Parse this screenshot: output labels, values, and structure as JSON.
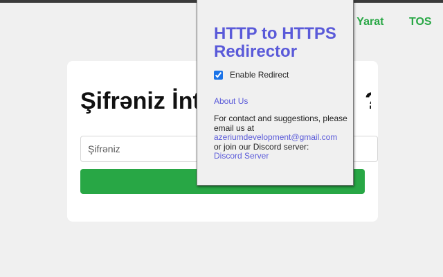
{
  "nav": {
    "create_label": "rə Yarat",
    "tos_label": "TOS"
  },
  "card": {
    "title_start": "Şifrəniz İnt",
    "title_end": "?",
    "password_placeholder": "Şifrəniz",
    "submit_label": ""
  },
  "popup": {
    "title": "HTTP to HTTPS Redirector",
    "enable_label": "Enable Redirect",
    "enable_checked": true,
    "about_label": "About Us",
    "contact_text_1": "For contact and suggestions, please email us at",
    "email": "azeriumdevelopment@gmail.com",
    "contact_text_2": "or join our Discord server:",
    "discord_label": "Discord Server"
  },
  "colors": {
    "accent_green": "#28a745",
    "popup_link": "#5a5ad9",
    "background": "#f0f0f0"
  }
}
